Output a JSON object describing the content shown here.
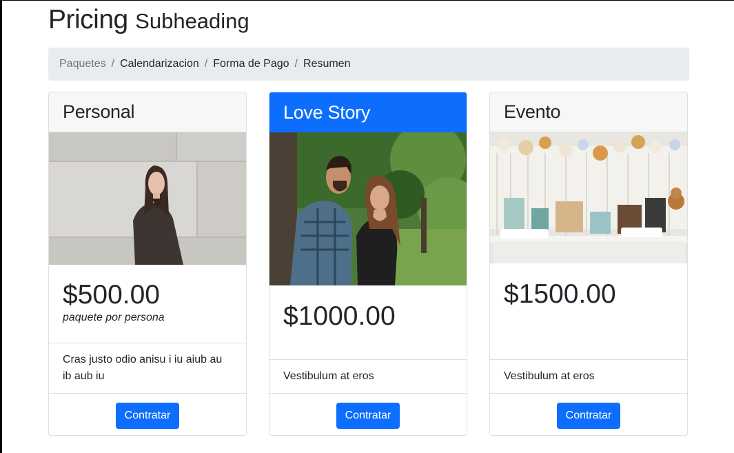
{
  "header": {
    "title": "Pricing",
    "subtitle": "Subheading"
  },
  "breadcrumb": [
    "Paquetes",
    "Calendarizacion",
    "Forma de Pago",
    "Resumen"
  ],
  "cards": [
    {
      "name": "Personal",
      "price": "$500.00",
      "note": "paquete por persona",
      "description": "Cras justo odio anisu i iu aiub au ib aub iu",
      "button": "Contratar"
    },
    {
      "name": "Love Story",
      "price": "$1000.00",
      "note": "",
      "description": "Vestibulum at eros",
      "button": "Contratar",
      "featured": true
    },
    {
      "name": "Evento",
      "price": "$1500.00",
      "note": "",
      "description": "Vestibulum at eros",
      "button": "Contratar"
    }
  ],
  "colors": {
    "primary": "#0d6efd",
    "breadcrumb_bg": "#e9ecef"
  }
}
